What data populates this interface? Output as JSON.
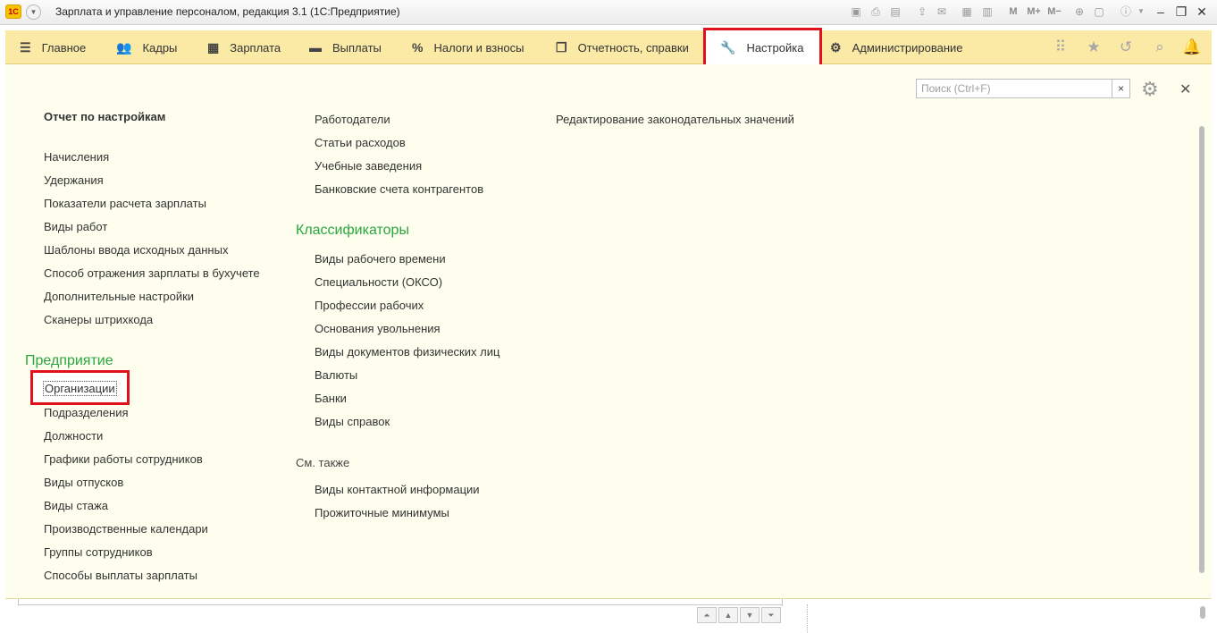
{
  "window": {
    "title": "Зарплата и управление персоналом, редакция 3.1  (1С:Предприятие)",
    "logo_text": "1С",
    "toolbar": [
      "М",
      "М+",
      "М−"
    ]
  },
  "nav": {
    "tabs": [
      {
        "label": "Главное",
        "icon": "menu-icon"
      },
      {
        "label": "Кадры",
        "icon": "people-icon"
      },
      {
        "label": "Зарплата",
        "icon": "calculator-icon"
      },
      {
        "label": "Выплаты",
        "icon": "wallet-icon"
      },
      {
        "label": "Налоги и взносы",
        "icon": "percent-icon"
      },
      {
        "label": "Отчетность, справки",
        "icon": "reports-icon"
      },
      {
        "label": "Настройка",
        "icon": "wrench-icon"
      },
      {
        "label": "Администрирование",
        "icon": "gear-icon"
      }
    ],
    "active_tab": "Настройка"
  },
  "panel": {
    "search_placeholder": "Поиск (Ctrl+F)",
    "col1": {
      "header": "Отчет по настройкам",
      "items": [
        "Начисления",
        "Удержания",
        "Показатели расчета зарплаты",
        "Виды работ",
        "Шаблоны ввода исходных данных",
        "Способ отражения зарплаты в бухучете",
        "Дополнительные настройки",
        "Сканеры штрихкода"
      ],
      "group_title": "Предприятие",
      "group_highlight": "Организации",
      "group_items": [
        "Подразделения",
        "Должности",
        "Графики работы сотрудников",
        "Виды отпусков",
        "Виды стажа",
        "Производственные календари",
        "Группы сотрудников",
        "Способы выплаты зарплаты"
      ]
    },
    "col2": {
      "items": [
        "Работодатели",
        "Статьи расходов",
        "Учебные заведения",
        "Банковские счета контрагентов"
      ],
      "group_title": "Классификаторы",
      "group_items": [
        "Виды рабочего времени",
        "Специальности (ОКСО)",
        "Профессии рабочих",
        "Основания увольнения",
        "Виды документов физических лиц",
        "Валюты",
        "Банки",
        "Виды справок"
      ],
      "see_also_title": "См. также",
      "see_also_items": [
        "Виды контактной информации",
        "Прожиточные минимумы"
      ]
    },
    "col3": {
      "items": [
        "Редактирование законодательных значений"
      ]
    }
  }
}
